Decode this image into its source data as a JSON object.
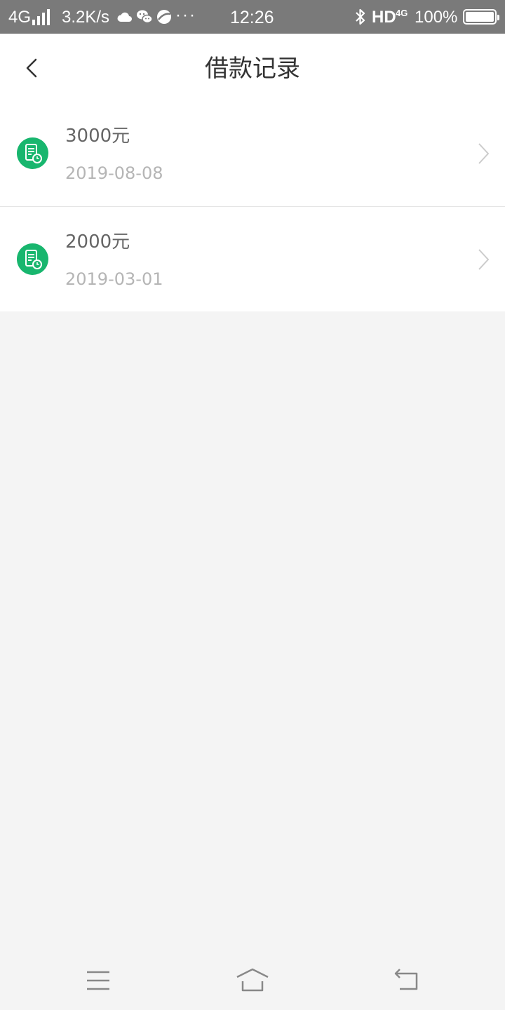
{
  "status_bar": {
    "network": "4G",
    "speed": "3.2K/s",
    "more": "···",
    "time": "12:26",
    "hd": "HD",
    "network2": "4G",
    "battery": "100%",
    "icons": [
      "signal-icon",
      "weather-icon",
      "wechat-icon",
      "browser-icon",
      "bluetooth-icon",
      "battery-icon"
    ]
  },
  "header": {
    "title": "借款记录",
    "back_icon": "chevron-left-icon"
  },
  "records": [
    {
      "amount": "3000元",
      "date": "2019-08-08"
    },
    {
      "amount": "2000元",
      "date": "2019-03-01"
    }
  ],
  "colors": {
    "accent": "#18b66e",
    "status_bar_bg": "#7a7a7a",
    "page_bg": "#f4f4f4",
    "title_text": "#333333",
    "amount_text": "#666666",
    "date_text": "#b5b5b5"
  },
  "system_nav": [
    "menu-icon",
    "home-icon",
    "back-icon"
  ]
}
